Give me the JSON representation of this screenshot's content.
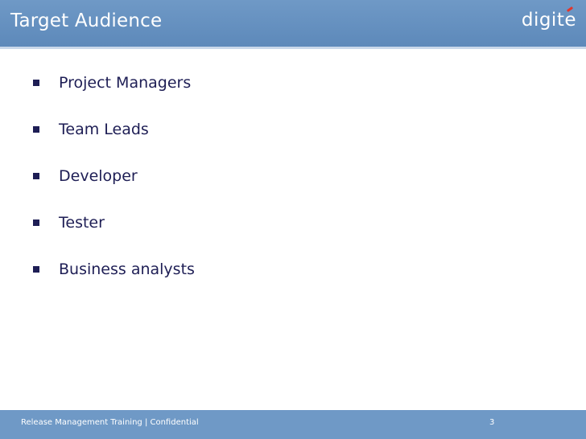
{
  "slide": {
    "title": "Target Audience",
    "logo": "digite",
    "bullets": [
      "Project Managers",
      "Team Leads",
      "Developer",
      "Tester",
      "Business analysts"
    ],
    "footer": "Release Management Training |  Confidential",
    "page_number": "3"
  }
}
